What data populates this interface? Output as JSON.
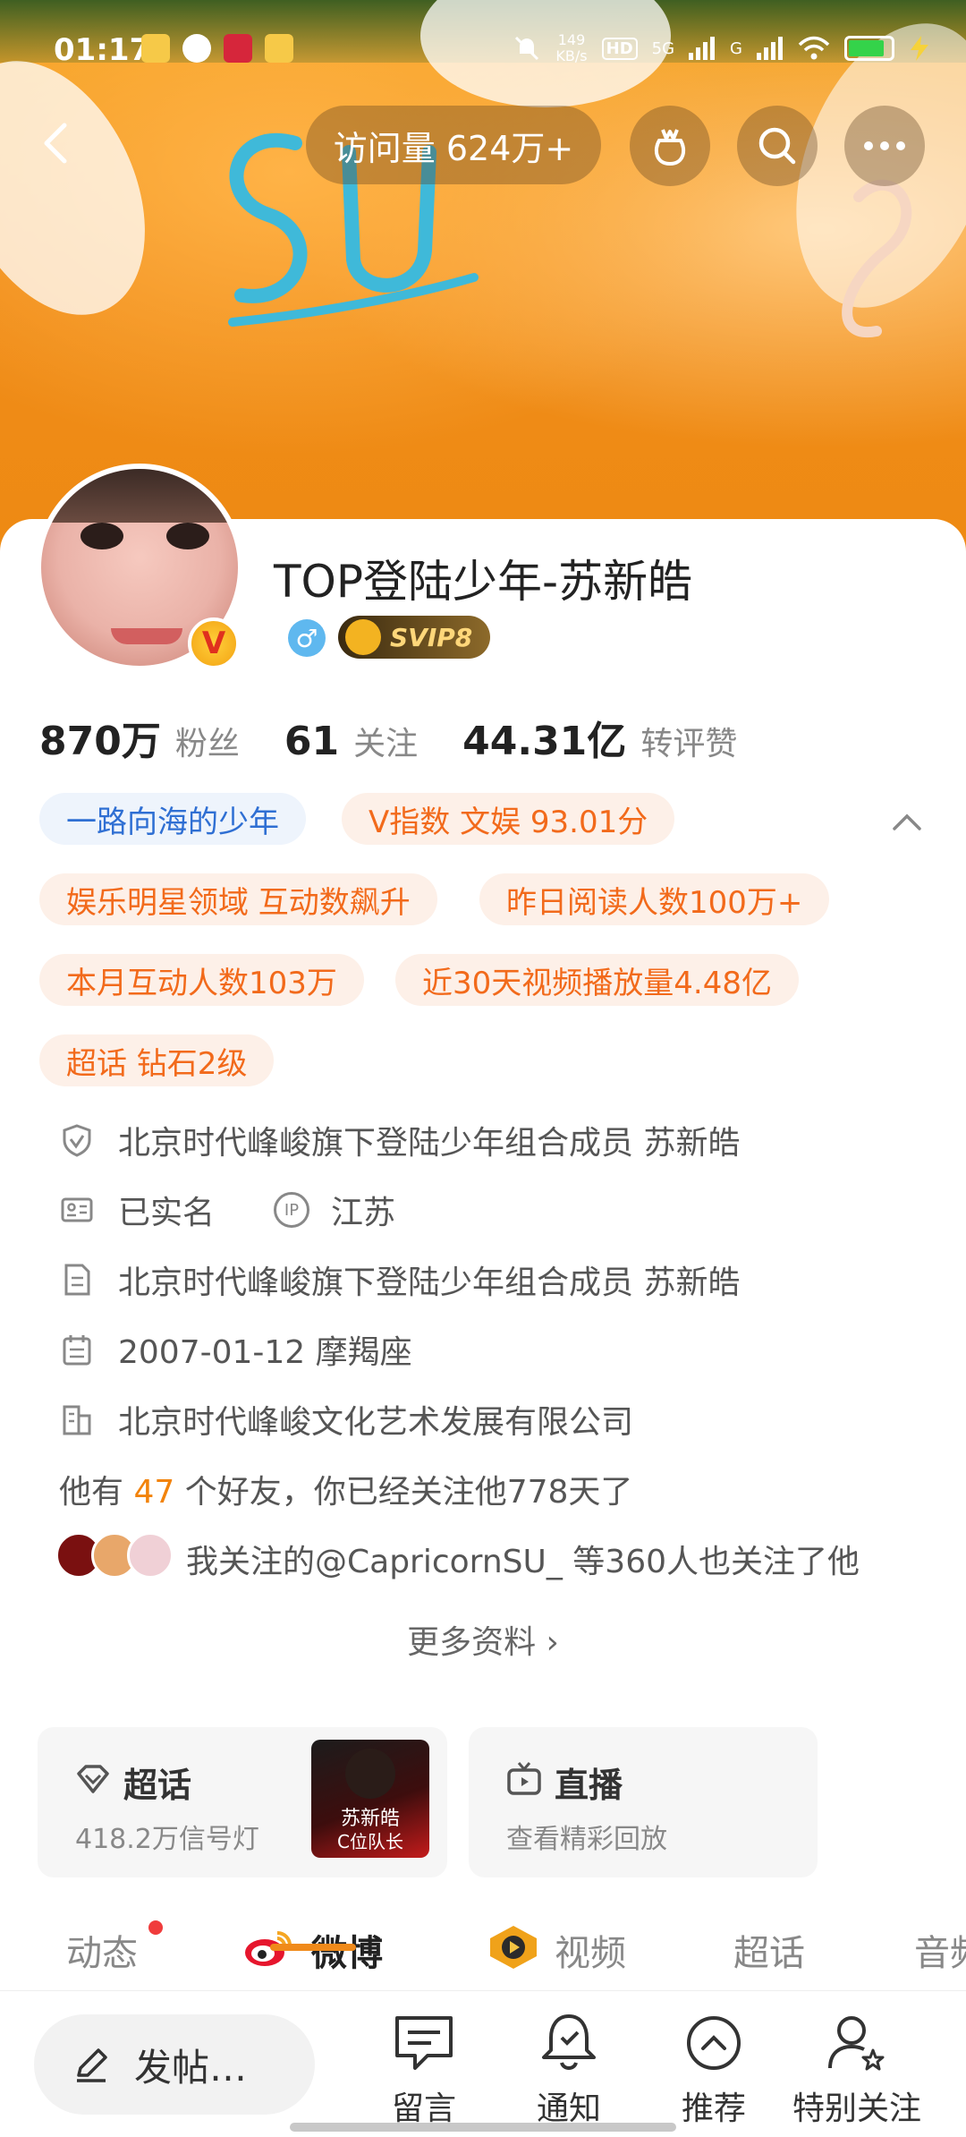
{
  "status_bar": {
    "time": "01:17",
    "net_speed_value": "149",
    "net_speed_unit": "KB/s",
    "hd": "HD",
    "signal1": "5G",
    "signal2": "G"
  },
  "header": {
    "visits": "访问量 624万+"
  },
  "profile": {
    "name": "TOP登陆少年-苏新皓",
    "gender_symbol": "♂",
    "svip": "SVIP8",
    "v_badge": "V"
  },
  "stats": [
    {
      "value": "870万",
      "label": "粉丝"
    },
    {
      "value": "61",
      "label": "关注"
    },
    {
      "value": "44.31亿",
      "label": "转评赞"
    }
  ],
  "tags": {
    "blue": "一路向海的少年",
    "v_index": "V指数 文娱 93.01分",
    "t1": "娱乐明星领域 互动数飙升",
    "t2": "昨日阅读人数100万+",
    "t3": "本月互动人数103万",
    "t4": "近30天视频播放量4.48亿",
    "t5": "超话 钻石2级"
  },
  "info": {
    "verification": "北京时代峰峻旗下登陆少年组合成员 苏新皓",
    "realname": "已实名",
    "ip_label": "IP",
    "ip_location": "江苏",
    "bio": "北京时代峰峻旗下登陆少年组合成员 苏新皓",
    "birthday": "2007-01-12 摩羯座",
    "company": "北京时代峰峻文化艺术发展有限公司",
    "friends_prefix": "他有 ",
    "friends_count": "47",
    "friends_suffix": " 个好友，你已经关注他778天了",
    "mutual": "我关注的@CapricornSU_ 等360人也关注了他",
    "more": "更多资料 ›"
  },
  "features": {
    "supertopic_title": "超话",
    "supertopic_sub": "418.2万信号灯",
    "thumb_name": "苏新皓",
    "thumb_sub": "C位队长",
    "live_title": "直播",
    "live_sub": "查看精彩回放"
  },
  "tabs": [
    "动态",
    "微博",
    "视频",
    "超话",
    "音频"
  ],
  "bottom": {
    "post": "发帖…",
    "message": "留言",
    "notify": "通知",
    "recommend": "推荐",
    "special": "特别关注"
  },
  "colors": {
    "accent_orange": "#f26a1b",
    "tag_blue": "#2f6fd3",
    "banner_orange": "#f08c1a"
  }
}
